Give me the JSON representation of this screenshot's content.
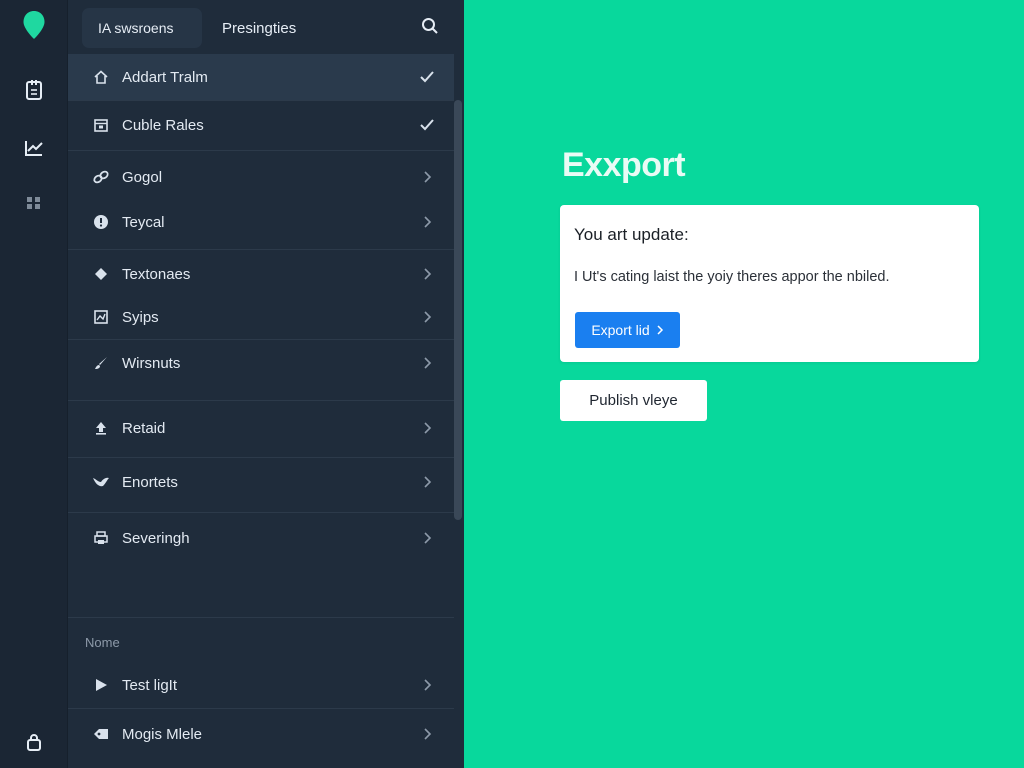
{
  "tabs": {
    "active_label": "IA swsroens",
    "second_label": "Presingties"
  },
  "nav": {
    "items": [
      {
        "label": "Addart Tralm",
        "icon": "home-icon",
        "end": "check-icon"
      },
      {
        "label": "Cuble Rales",
        "icon": "calendar-icon",
        "end": "check-icon"
      },
      {
        "label": "Gogol",
        "icon": "link-icon",
        "end": "chevron-right-icon"
      },
      {
        "label": "Teycal",
        "icon": "info-icon",
        "end": "chevron-right-icon"
      },
      {
        "label": "Textonaes",
        "icon": "diamond-icon",
        "end": "chevron-right-icon"
      },
      {
        "label": "Syips",
        "icon": "image-icon",
        "end": "chevron-right-icon"
      },
      {
        "label": "Wirsnuts",
        "icon": "brush-icon",
        "end": "chevron-right-icon"
      },
      {
        "label": "Retaid",
        "icon": "upload-icon",
        "end": "chevron-right-icon"
      },
      {
        "label": "Enortets",
        "icon": "bird-icon",
        "end": "chevron-right-icon"
      },
      {
        "label": "Severingh",
        "icon": "printer-icon",
        "end": "chevron-right-icon"
      }
    ],
    "section_label": "Nome",
    "section_items": [
      {
        "label": "Test ligIt",
        "icon": "play-icon",
        "end": "chevron-right-icon"
      },
      {
        "label": "Mogis Mlele",
        "icon": "tag-icon",
        "end": "chevron-right-icon"
      }
    ]
  },
  "main": {
    "title": "Exxport",
    "card": {
      "heading": "You art update:",
      "body": "I Ut's cating laist the yoiy theres appor the nbiled.",
      "primary_button": "Export lid"
    },
    "secondary_button": "Publish vleye"
  },
  "colors": {
    "rail": "#1b2634",
    "panel": "#1f2c3b",
    "selected_row": "#2a3a4c",
    "accent": "#08d89c",
    "primary_button": "#1a7ff0",
    "logo": "#1fd8a0"
  }
}
